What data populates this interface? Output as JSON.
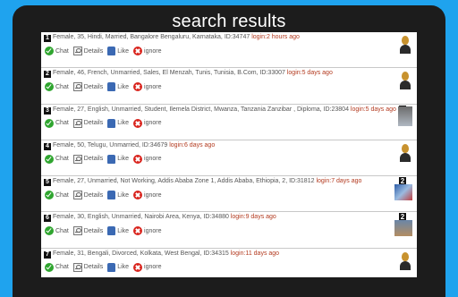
{
  "header": {
    "title": "search results"
  },
  "actions": {
    "chat": "Chat",
    "details": "Details",
    "like": "Like",
    "ignore": "ignore"
  },
  "results": [
    {
      "num": "1",
      "info": "Female, 35, Hindi, Married, Bangalore Bengaluru, Karnataka, ID:34747",
      "login": "login:2 hours ago",
      "photo": "woman-avatar",
      "badge": ""
    },
    {
      "num": "2",
      "info": "Female, 46, French, Unmarried, Sales, El Menzah, Tunis, Tunisia, B.Com, ID:33007",
      "login": "login:5 days ago",
      "photo": "woman-avatar",
      "badge": ""
    },
    {
      "num": "3",
      "info": "Female, 27, English, Unmarried, Student, Ilemela District, Mwanza, Tanzania Zanzibar , Diploma, ID:23804",
      "login": "login:5 days ago",
      "photo": "photo",
      "badge": "2"
    },
    {
      "num": "4",
      "info": "Female, 50, Telugu, Unmarried, ID:34679",
      "login": "login:6 days ago",
      "photo": "woman-avatar",
      "badge": ""
    },
    {
      "num": "5",
      "info": "Female, 27, Unmarried, Not Working, Addis Ababa Zone 1, Addis Ababa, Ethiopia, 2, ID:31812",
      "login": "login:7 days ago",
      "photo": "photo",
      "badge": "2"
    },
    {
      "num": "6",
      "info": "Female, 30, English, Unmarried, Nairobi Area, Kenya, ID:34880",
      "login": "login:9 days ago",
      "photo": "photo",
      "badge": "2"
    },
    {
      "num": "7",
      "info": "Female, 31, Bengali, Divorced, Kolkata, West Bengal, ID:34315",
      "login": "login:11 days ago",
      "photo": "woman-avatar",
      "badge": ""
    }
  ]
}
